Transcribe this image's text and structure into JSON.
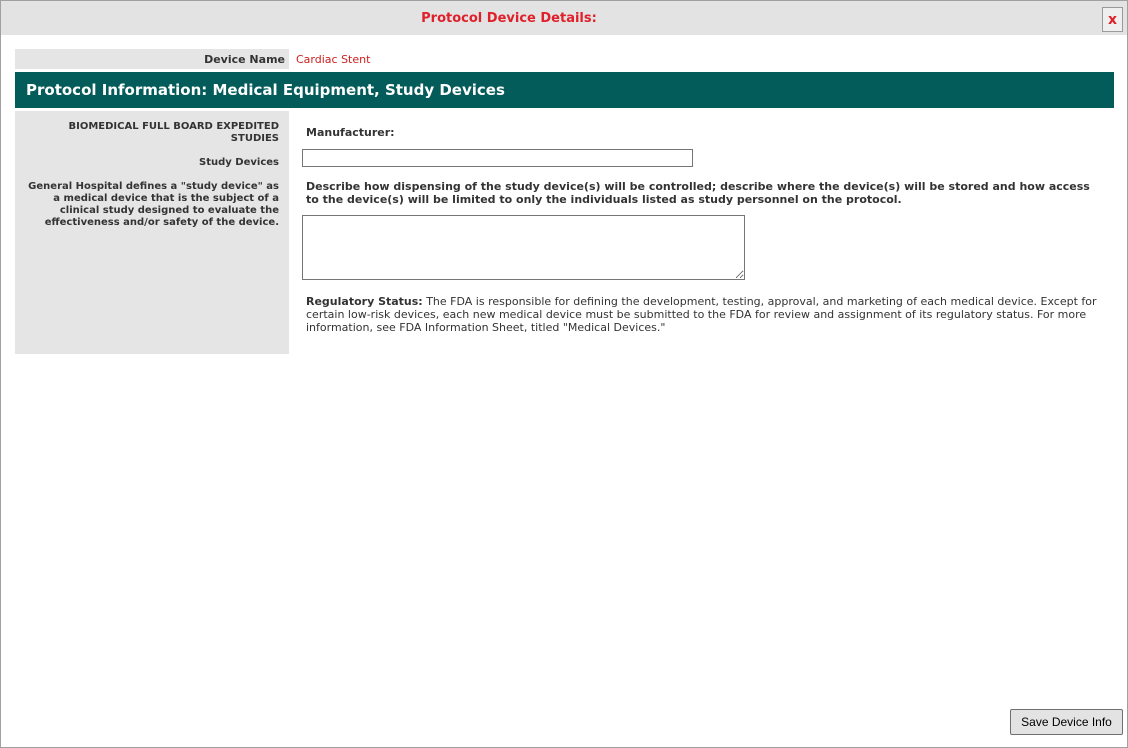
{
  "window": {
    "title": "Protocol Device Details:",
    "close_label": "x"
  },
  "device": {
    "name_label": "Device Name",
    "name_value": "Cardiac Stent"
  },
  "section": {
    "header": "Protocol Information: Medical Equipment, Study Devices"
  },
  "left_panel": {
    "heading": "BIOMEDICAL FULL BOARD EXPEDITED STUDIES",
    "subheading": "Study Devices",
    "description": "General Hospital  defines a \"study device\" as a medical device that is the subject of a clinical study designed to evaluate the effectiveness and/or safety of the device."
  },
  "form": {
    "manufacturer_label": "Manufacturer:",
    "manufacturer_value": "",
    "dispensing_label": "Describe how dispensing of the study device(s) will be controlled; describe where the device(s) will be stored and how access to the device(s) will be limited to only the individuals listed as study personnel on the protocol.",
    "dispensing_value": "",
    "regulatory_label": "Regulatory Status:",
    "regulatory_text": " The FDA is responsible for defining the development, testing, approval, and marketing of each medical device. Except for certain low-risk devices, each new medical device must be submitted to the FDA for review and assignment of its regulatory status. For more information, see FDA Information Sheet, titled \"Medical Devices.\""
  },
  "footer": {
    "save_label": "Save Device Info"
  },
  "colors": {
    "title_red": "#e0202a",
    "header_teal": "#035b5a",
    "panel_gray": "#e5e5e5",
    "value_red": "#cc1f1f"
  }
}
